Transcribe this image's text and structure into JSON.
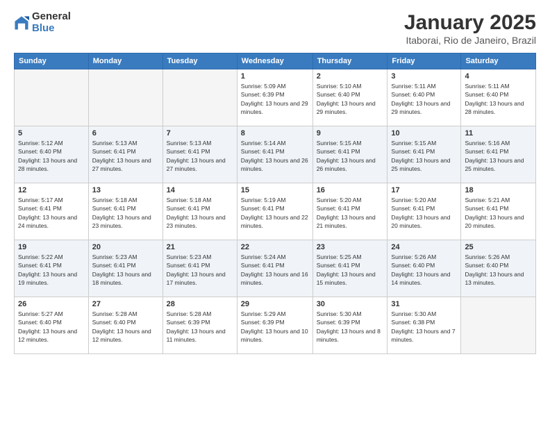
{
  "header": {
    "logo_general": "General",
    "logo_blue": "Blue",
    "title": "January 2025",
    "subtitle": "Itaborai, Rio de Janeiro, Brazil"
  },
  "weekdays": [
    "Sunday",
    "Monday",
    "Tuesday",
    "Wednesday",
    "Thursday",
    "Friday",
    "Saturday"
  ],
  "weeks": [
    [
      {
        "num": "",
        "sunrise": "",
        "sunset": "",
        "daylight": ""
      },
      {
        "num": "",
        "sunrise": "",
        "sunset": "",
        "daylight": ""
      },
      {
        "num": "",
        "sunrise": "",
        "sunset": "",
        "daylight": ""
      },
      {
        "num": "1",
        "sunrise": "Sunrise: 5:09 AM",
        "sunset": "Sunset: 6:39 PM",
        "daylight": "Daylight: 13 hours and 29 minutes."
      },
      {
        "num": "2",
        "sunrise": "Sunrise: 5:10 AM",
        "sunset": "Sunset: 6:40 PM",
        "daylight": "Daylight: 13 hours and 29 minutes."
      },
      {
        "num": "3",
        "sunrise": "Sunrise: 5:11 AM",
        "sunset": "Sunset: 6:40 PM",
        "daylight": "Daylight: 13 hours and 29 minutes."
      },
      {
        "num": "4",
        "sunrise": "Sunrise: 5:11 AM",
        "sunset": "Sunset: 6:40 PM",
        "daylight": "Daylight: 13 hours and 28 minutes."
      }
    ],
    [
      {
        "num": "5",
        "sunrise": "Sunrise: 5:12 AM",
        "sunset": "Sunset: 6:40 PM",
        "daylight": "Daylight: 13 hours and 28 minutes."
      },
      {
        "num": "6",
        "sunrise": "Sunrise: 5:13 AM",
        "sunset": "Sunset: 6:41 PM",
        "daylight": "Daylight: 13 hours and 27 minutes."
      },
      {
        "num": "7",
        "sunrise": "Sunrise: 5:13 AM",
        "sunset": "Sunset: 6:41 PM",
        "daylight": "Daylight: 13 hours and 27 minutes."
      },
      {
        "num": "8",
        "sunrise": "Sunrise: 5:14 AM",
        "sunset": "Sunset: 6:41 PM",
        "daylight": "Daylight: 13 hours and 26 minutes."
      },
      {
        "num": "9",
        "sunrise": "Sunrise: 5:15 AM",
        "sunset": "Sunset: 6:41 PM",
        "daylight": "Daylight: 13 hours and 26 minutes."
      },
      {
        "num": "10",
        "sunrise": "Sunrise: 5:15 AM",
        "sunset": "Sunset: 6:41 PM",
        "daylight": "Daylight: 13 hours and 25 minutes."
      },
      {
        "num": "11",
        "sunrise": "Sunrise: 5:16 AM",
        "sunset": "Sunset: 6:41 PM",
        "daylight": "Daylight: 13 hours and 25 minutes."
      }
    ],
    [
      {
        "num": "12",
        "sunrise": "Sunrise: 5:17 AM",
        "sunset": "Sunset: 6:41 PM",
        "daylight": "Daylight: 13 hours and 24 minutes."
      },
      {
        "num": "13",
        "sunrise": "Sunrise: 5:18 AM",
        "sunset": "Sunset: 6:41 PM",
        "daylight": "Daylight: 13 hours and 23 minutes."
      },
      {
        "num": "14",
        "sunrise": "Sunrise: 5:18 AM",
        "sunset": "Sunset: 6:41 PM",
        "daylight": "Daylight: 13 hours and 23 minutes."
      },
      {
        "num": "15",
        "sunrise": "Sunrise: 5:19 AM",
        "sunset": "Sunset: 6:41 PM",
        "daylight": "Daylight: 13 hours and 22 minutes."
      },
      {
        "num": "16",
        "sunrise": "Sunrise: 5:20 AM",
        "sunset": "Sunset: 6:41 PM",
        "daylight": "Daylight: 13 hours and 21 minutes."
      },
      {
        "num": "17",
        "sunrise": "Sunrise: 5:20 AM",
        "sunset": "Sunset: 6:41 PM",
        "daylight": "Daylight: 13 hours and 20 minutes."
      },
      {
        "num": "18",
        "sunrise": "Sunrise: 5:21 AM",
        "sunset": "Sunset: 6:41 PM",
        "daylight": "Daylight: 13 hours and 20 minutes."
      }
    ],
    [
      {
        "num": "19",
        "sunrise": "Sunrise: 5:22 AM",
        "sunset": "Sunset: 6:41 PM",
        "daylight": "Daylight: 13 hours and 19 minutes."
      },
      {
        "num": "20",
        "sunrise": "Sunrise: 5:23 AM",
        "sunset": "Sunset: 6:41 PM",
        "daylight": "Daylight: 13 hours and 18 minutes."
      },
      {
        "num": "21",
        "sunrise": "Sunrise: 5:23 AM",
        "sunset": "Sunset: 6:41 PM",
        "daylight": "Daylight: 13 hours and 17 minutes."
      },
      {
        "num": "22",
        "sunrise": "Sunrise: 5:24 AM",
        "sunset": "Sunset: 6:41 PM",
        "daylight": "Daylight: 13 hours and 16 minutes."
      },
      {
        "num": "23",
        "sunrise": "Sunrise: 5:25 AM",
        "sunset": "Sunset: 6:41 PM",
        "daylight": "Daylight: 13 hours and 15 minutes."
      },
      {
        "num": "24",
        "sunrise": "Sunrise: 5:26 AM",
        "sunset": "Sunset: 6:40 PM",
        "daylight": "Daylight: 13 hours and 14 minutes."
      },
      {
        "num": "25",
        "sunrise": "Sunrise: 5:26 AM",
        "sunset": "Sunset: 6:40 PM",
        "daylight": "Daylight: 13 hours and 13 minutes."
      }
    ],
    [
      {
        "num": "26",
        "sunrise": "Sunrise: 5:27 AM",
        "sunset": "Sunset: 6:40 PM",
        "daylight": "Daylight: 13 hours and 12 minutes."
      },
      {
        "num": "27",
        "sunrise": "Sunrise: 5:28 AM",
        "sunset": "Sunset: 6:40 PM",
        "daylight": "Daylight: 13 hours and 12 minutes."
      },
      {
        "num": "28",
        "sunrise": "Sunrise: 5:28 AM",
        "sunset": "Sunset: 6:39 PM",
        "daylight": "Daylight: 13 hours and 11 minutes."
      },
      {
        "num": "29",
        "sunrise": "Sunrise: 5:29 AM",
        "sunset": "Sunset: 6:39 PM",
        "daylight": "Daylight: 13 hours and 10 minutes."
      },
      {
        "num": "30",
        "sunrise": "Sunrise: 5:30 AM",
        "sunset": "Sunset: 6:39 PM",
        "daylight": "Daylight: 13 hours and 8 minutes."
      },
      {
        "num": "31",
        "sunrise": "Sunrise: 5:30 AM",
        "sunset": "Sunset: 6:38 PM",
        "daylight": "Daylight: 13 hours and 7 minutes."
      },
      {
        "num": "",
        "sunrise": "",
        "sunset": "",
        "daylight": ""
      }
    ]
  ]
}
